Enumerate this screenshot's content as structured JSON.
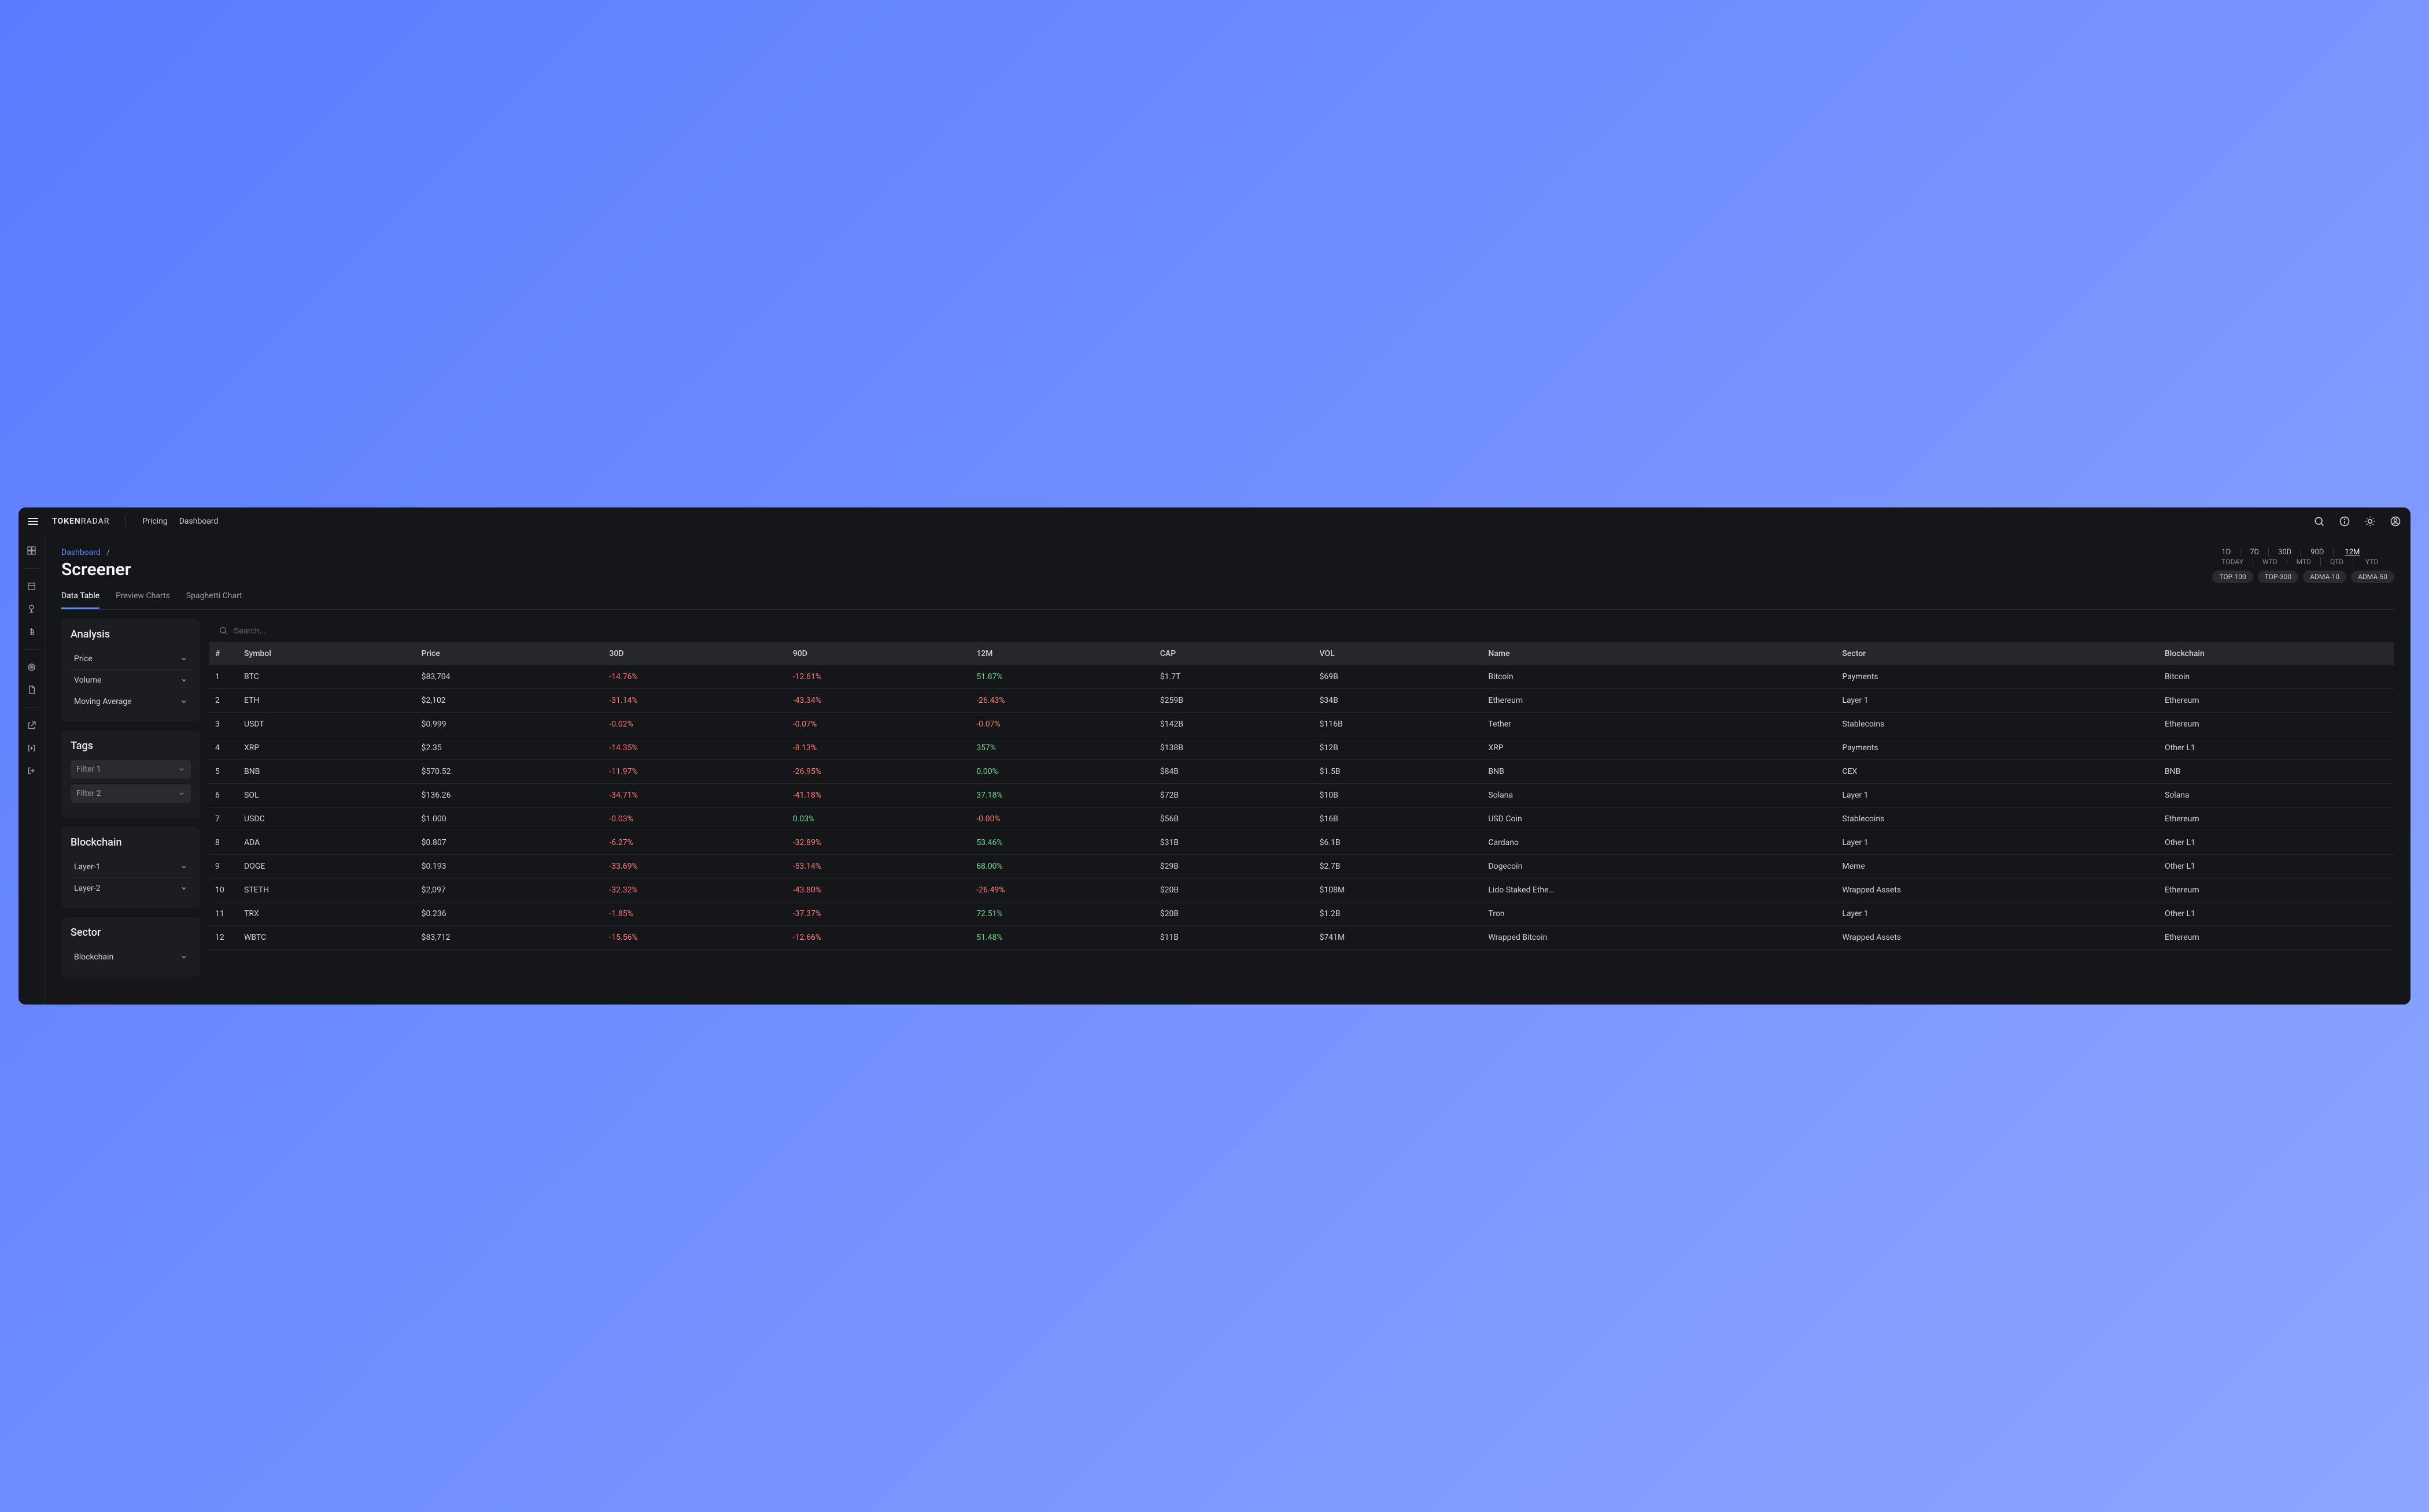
{
  "brand": {
    "bold": "TOKEN",
    "light": "RADAR"
  },
  "nav": {
    "pricing": "Pricing",
    "dashboard": "Dashboard"
  },
  "breadcrumb": {
    "root": "Dashboard",
    "sep": "/"
  },
  "page_title": "Screener",
  "periods": {
    "top": [
      "1D",
      "7D",
      "30D",
      "90D",
      "12M"
    ],
    "bottom": [
      "TODAY",
      "WTD",
      "MTD",
      "QTD",
      "YTD"
    ],
    "active": "12M"
  },
  "chips": [
    "TOP-100",
    "TOP-300",
    "ADMA-10",
    "ADMA-50"
  ],
  "tabs": {
    "items": [
      "Data Table",
      "Preview Charts",
      "Spaghetti Chart"
    ],
    "active": "Data Table"
  },
  "filters": {
    "analysis": {
      "title": "Analysis",
      "items": [
        "Price",
        "Volume",
        "Moving Average"
      ]
    },
    "tags": {
      "title": "Tags",
      "items": [
        "Filter 1",
        "Filter 2"
      ]
    },
    "blockchain": {
      "title": "Blockchain",
      "items": [
        "Layer-1",
        "Layer-2"
      ]
    },
    "sector": {
      "title": "Sector",
      "items": [
        "Blockchain"
      ]
    }
  },
  "search": {
    "placeholder": "Search..."
  },
  "table": {
    "headers": [
      "#",
      "Symbol",
      "Price",
      "30D",
      "90D",
      "12M",
      "CAP",
      "VOL",
      "Name",
      "Sector",
      "Blockchain"
    ],
    "rows": [
      {
        "idx": "1",
        "symbol": "BTC",
        "price": "$83,704",
        "d30": "-14.76%",
        "d90": "-12.61%",
        "m12": "51.87%",
        "cap": "$1.7T",
        "vol": "$69B",
        "name": "Bitcoin",
        "sector": "Payments",
        "bc": "Bitcoin"
      },
      {
        "idx": "2",
        "symbol": "ETH",
        "price": "$2,102",
        "d30": "-31.14%",
        "d90": "-43.34%",
        "m12": "-26.43%",
        "cap": "$259B",
        "vol": "$34B",
        "name": "Ethereum",
        "sector": "Layer 1",
        "bc": "Ethereum"
      },
      {
        "idx": "3",
        "symbol": "USDT",
        "price": "$0.999",
        "d30": "-0.02%",
        "d90": "-0.07%",
        "m12": "-0.07%",
        "cap": "$142B",
        "vol": "$116B",
        "name": "Tether",
        "sector": "Stablecoins",
        "bc": "Ethereum"
      },
      {
        "idx": "4",
        "symbol": "XRP",
        "price": "$2.35",
        "d30": "-14.35%",
        "d90": "-8.13%",
        "m12": "357%",
        "cap": "$138B",
        "vol": "$12B",
        "name": "XRP",
        "sector": "Payments",
        "bc": "Other L1"
      },
      {
        "idx": "5",
        "symbol": "BNB",
        "price": "$570.52",
        "d30": "-11.97%",
        "d90": "-26.95%",
        "m12": "0.00%",
        "cap": "$84B",
        "vol": "$1.5B",
        "name": "BNB",
        "sector": "CEX",
        "bc": "BNB"
      },
      {
        "idx": "6",
        "symbol": "SOL",
        "price": "$136.26",
        "d30": "-34.71%",
        "d90": "-41.18%",
        "m12": "37.18%",
        "cap": "$72B",
        "vol": "$10B",
        "name": "Solana",
        "sector": "Layer 1",
        "bc": "Solana"
      },
      {
        "idx": "7",
        "symbol": "USDC",
        "price": "$1.000",
        "d30": "-0.03%",
        "d90": "0.03%",
        "m12": "-0.00%",
        "cap": "$56B",
        "vol": "$16B",
        "name": "USD Coin",
        "sector": "Stablecoins",
        "bc": "Ethereum"
      },
      {
        "idx": "8",
        "symbol": "ADA",
        "price": "$0.807",
        "d30": "-6.27%",
        "d90": "-32.89%",
        "m12": "53.46%",
        "cap": "$31B",
        "vol": "$6.1B",
        "name": "Cardano",
        "sector": "Layer 1",
        "bc": "Other L1"
      },
      {
        "idx": "9",
        "symbol": "DOGE",
        "price": "$0.193",
        "d30": "-33.69%",
        "d90": "-53.14%",
        "m12": "68.00%",
        "cap": "$29B",
        "vol": "$2.7B",
        "name": "Dogecoin",
        "sector": "Meme",
        "bc": "Other L1"
      },
      {
        "idx": "10",
        "symbol": "STETH",
        "price": "$2,097",
        "d30": "-32.32%",
        "d90": "-43.80%",
        "m12": "-26.49%",
        "cap": "$20B",
        "vol": "$108M",
        "name": "Lido Staked Ethe…",
        "sector": "Wrapped Assets",
        "bc": "Ethereum"
      },
      {
        "idx": "11",
        "symbol": "TRX",
        "price": "$0.236",
        "d30": "-1.85%",
        "d90": "-37.37%",
        "m12": "72.51%",
        "cap": "$20B",
        "vol": "$1.2B",
        "name": "Tron",
        "sector": "Layer 1",
        "bc": "Other L1"
      },
      {
        "idx": "12",
        "symbol": "WBTC",
        "price": "$83,712",
        "d30": "-15.56%",
        "d90": "-12.66%",
        "m12": "51.48%",
        "cap": "$11B",
        "vol": "$741M",
        "name": "Wrapped Bitcoin",
        "sector": "Wrapped Assets",
        "bc": "Ethereum"
      }
    ]
  }
}
